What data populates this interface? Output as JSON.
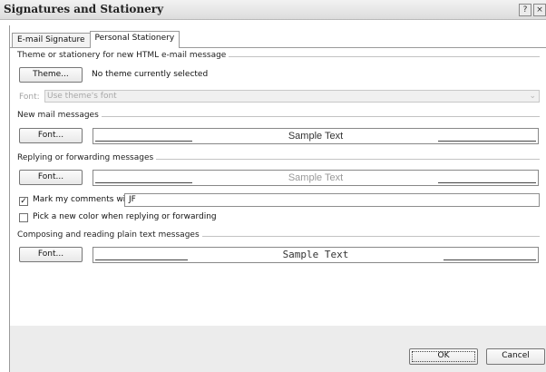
{
  "window": {
    "title": "Signatures and Stationery",
    "help_label": "?",
    "close_label": "×"
  },
  "tabs": [
    {
      "label": "E-mail Signature",
      "active": false
    },
    {
      "label": "Personal Stationery",
      "active": true
    }
  ],
  "theme_section": {
    "heading": "Theme or stationery for new HTML e-mail message",
    "theme_button": "Theme...",
    "theme_status": "No theme currently selected",
    "font_label": "Font:",
    "font_value": "Use theme's font"
  },
  "new_mail": {
    "heading": "New mail messages",
    "font_button": "Font...",
    "sample": "Sample Text"
  },
  "reply": {
    "heading": "Replying or forwarding messages",
    "font_button": "Font...",
    "sample": "Sample Text",
    "mark_comments_label": "Mark my comments with:",
    "mark_comments_checked": true,
    "mark_comments_value": "JF",
    "pick_color_label": "Pick a new color when replying or forwarding",
    "pick_color_checked": false
  },
  "plain_text": {
    "heading": "Composing and reading plain text messages",
    "font_button": "Font...",
    "sample": "Sample Text"
  },
  "footer": {
    "ok": "OK",
    "cancel": "Cancel"
  }
}
